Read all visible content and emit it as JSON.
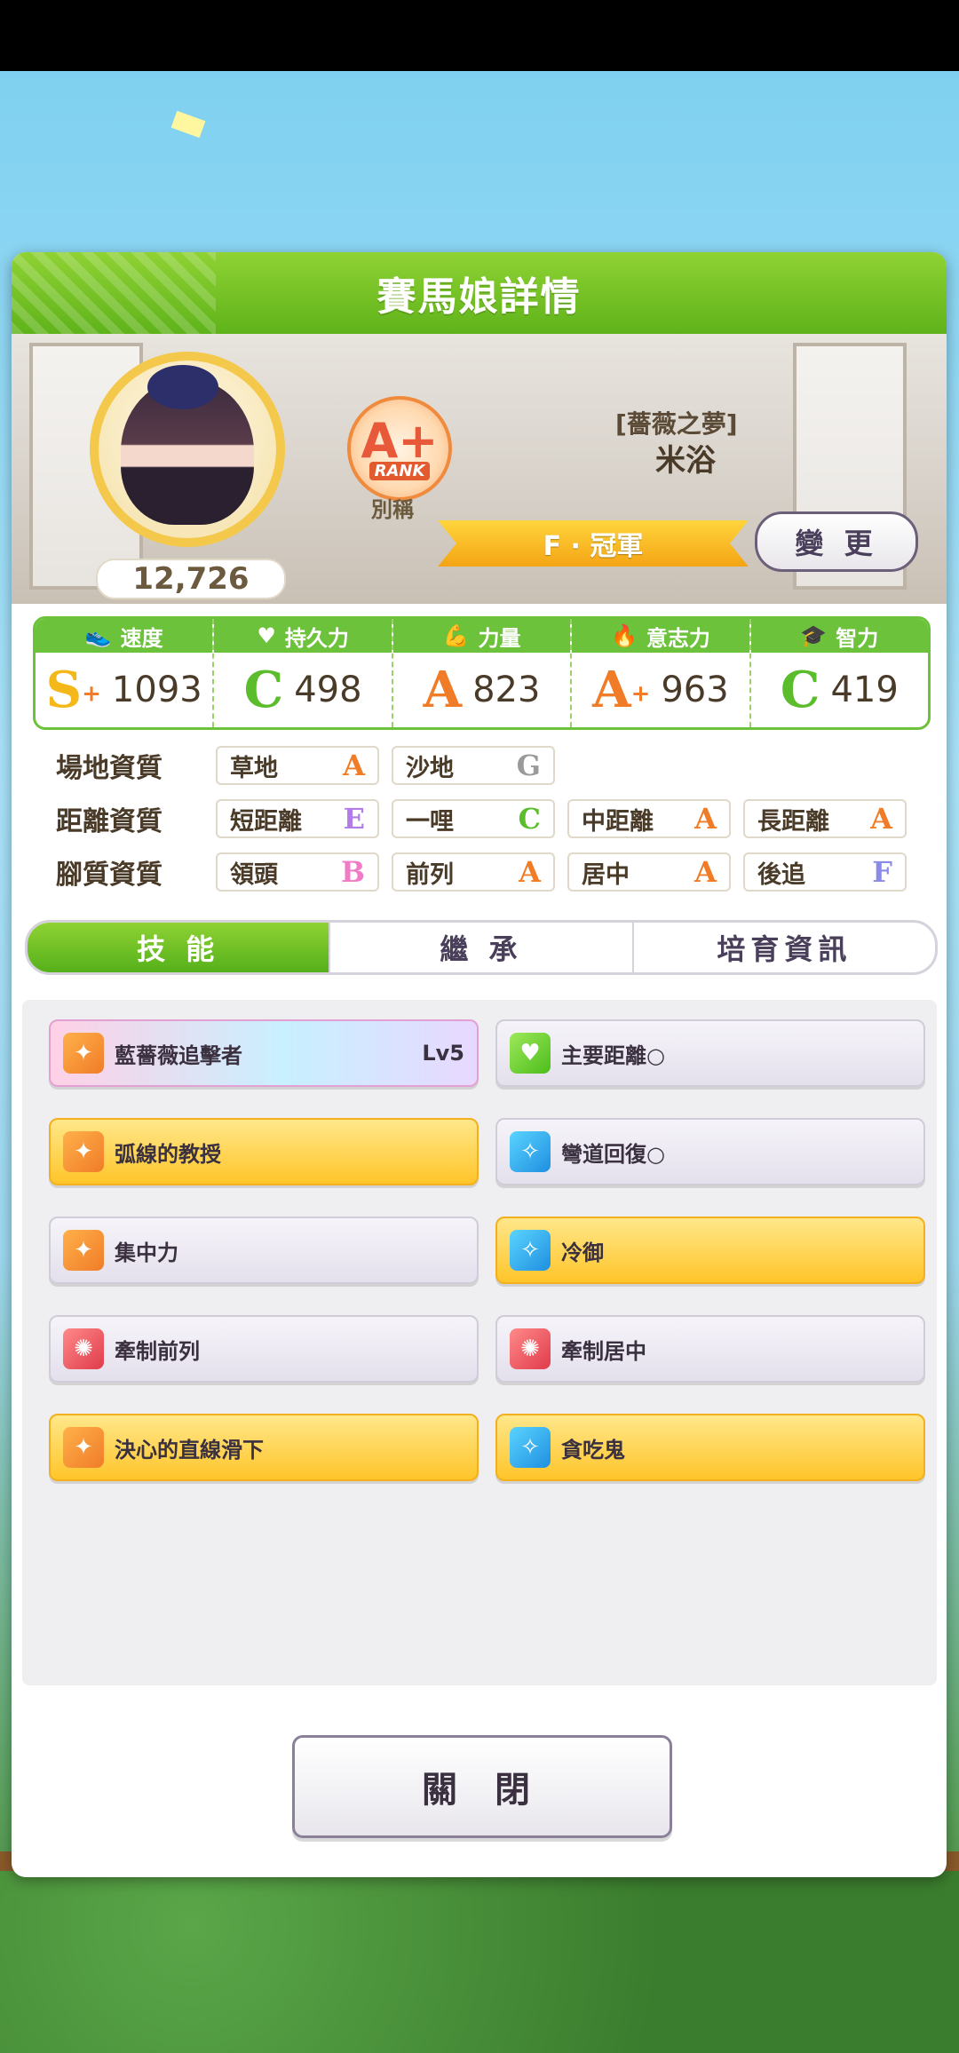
{
  "modal": {
    "title": "賽馬娘詳情"
  },
  "profile": {
    "score": "12,726",
    "rank": {
      "letter": "A+",
      "word": "RANK"
    },
    "alias_label": "別稱",
    "title_name": "[薔薇之夢]",
    "char_name": "米浴",
    "title": "F · 冠軍",
    "change_label": "變 更"
  },
  "stats": [
    {
      "name": "速度",
      "icon": "shoe-icon",
      "grade": "S",
      "plus": "+",
      "value": "1093"
    },
    {
      "name": "持久力",
      "icon": "heart-icon",
      "grade": "C",
      "plus": "",
      "value": "498"
    },
    {
      "name": "力量",
      "icon": "muscle-icon",
      "grade": "A",
      "plus": "",
      "value": "823"
    },
    {
      "name": "意志力",
      "icon": "flame-icon",
      "grade": "A",
      "plus": "+",
      "value": "963"
    },
    {
      "name": "智力",
      "icon": "graduation-cap-icon",
      "grade": "C",
      "plus": "",
      "value": "419"
    }
  ],
  "aptitude": {
    "track": {
      "label": "場地資質",
      "items": [
        {
          "name": "草地",
          "grade": "A"
        },
        {
          "name": "沙地",
          "grade": "G"
        }
      ]
    },
    "distance": {
      "label": "距離資質",
      "items": [
        {
          "name": "短距離",
          "grade": "E"
        },
        {
          "name": "一哩",
          "grade": "C"
        },
        {
          "name": "中距離",
          "grade": "A"
        },
        {
          "name": "長距離",
          "grade": "A"
        }
      ]
    },
    "style": {
      "label": "腳質資質",
      "items": [
        {
          "name": "領頭",
          "grade": "B"
        },
        {
          "name": "前列",
          "grade": "A"
        },
        {
          "name": "居中",
          "grade": "A"
        },
        {
          "name": "後追",
          "grade": "F"
        }
      ]
    }
  },
  "tabs": [
    "技 能",
    "繼 承",
    "培育資訊"
  ],
  "skills": [
    {
      "name": "藍薔薇追擊者",
      "lv": "Lv5",
      "style": "rainbow",
      "icon": "orange"
    },
    {
      "name": "主要距離○",
      "lv": "",
      "style": "normal",
      "icon": "green"
    },
    {
      "name": "弧線的教授",
      "lv": "",
      "style": "gold",
      "icon": "orange"
    },
    {
      "name": "彎道回復○",
      "lv": "",
      "style": "normal",
      "icon": "blue"
    },
    {
      "name": "集中力",
      "lv": "",
      "style": "normal",
      "icon": "orange"
    },
    {
      "name": "冷御",
      "lv": "",
      "style": "gold",
      "icon": "blue"
    },
    {
      "name": "牽制前列",
      "lv": "",
      "style": "normal",
      "icon": "red"
    },
    {
      "name": "牽制居中",
      "lv": "",
      "style": "normal",
      "icon": "red"
    },
    {
      "name": "決心的直線滑下",
      "lv": "",
      "style": "gold",
      "icon": "orange"
    },
    {
      "name": "貪吃鬼",
      "lv": "",
      "style": "gold",
      "icon": "blue"
    }
  ],
  "close_label": "關 閉"
}
